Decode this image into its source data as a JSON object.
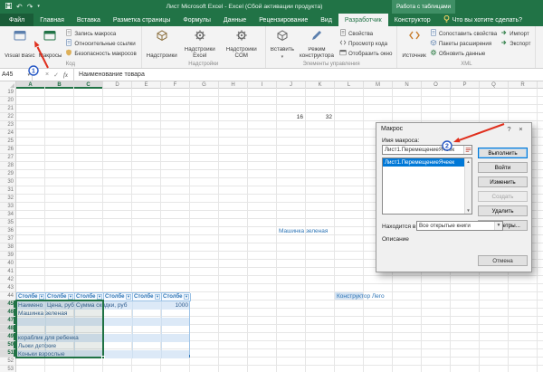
{
  "window": {
    "title": "Лист Microsoft Excel - Excel (Сбой активации продукта)",
    "context_group_label": "Работа с таблицами",
    "qat": [
      {
        "name": "save",
        "glyph": "save-icon"
      },
      {
        "name": "undo",
        "glyph": "↶"
      },
      {
        "name": "redo",
        "glyph": "↷"
      },
      {
        "name": "customize",
        "glyph": "▾"
      }
    ]
  },
  "tabs": [
    {
      "label": "Файл",
      "name": "file",
      "file": true
    },
    {
      "label": "Главная",
      "name": "home"
    },
    {
      "label": "Вставка",
      "name": "insert"
    },
    {
      "label": "Разметка страницы",
      "name": "page-layout"
    },
    {
      "label": "Формулы",
      "name": "formulas"
    },
    {
      "label": "Данные",
      "name": "data"
    },
    {
      "label": "Рецензирование",
      "name": "review"
    },
    {
      "label": "Вид",
      "name": "view"
    },
    {
      "label": "Разработчик",
      "name": "developer",
      "active": true
    },
    {
      "label": "Конструктор",
      "name": "design",
      "contextual": true
    }
  ],
  "tell_me": "Что вы хотите сделать?",
  "ribbon": {
    "groups": [
      {
        "label": "Код",
        "big": [
          {
            "label": "Visual Basic",
            "name": "visual-basic",
            "icon": "vb"
          },
          {
            "label": "Макросы",
            "name": "macros",
            "icon": "macros"
          }
        ],
        "small_cols": [
          [
            {
              "label": "Запись макроса",
              "name": "record-macro",
              "icon": "record"
            },
            {
              "label": "Относительные ссылки",
              "name": "relative-references",
              "icon": "relref"
            },
            {
              "label": "Безопасность макросов",
              "name": "macro-security",
              "icon": "security"
            }
          ]
        ]
      },
      {
        "label": "Надстройки",
        "big": [
          {
            "label": "Надстройки",
            "name": "add-ins",
            "icon": "addins"
          },
          {
            "label": "Надстройки Excel",
            "name": "excel-add-ins",
            "icon": "addins-excel"
          },
          {
            "label": "Надстройки COM",
            "name": "com-add-ins",
            "icon": "addins-com"
          }
        ],
        "small_cols": []
      },
      {
        "label": "Элементы управления",
        "big": [
          {
            "label": "Вставить",
            "name": "insert-controls",
            "icon": "insert",
            "menu": true
          },
          {
            "label": "Режим конструктора",
            "name": "design-mode",
            "icon": "design"
          }
        ],
        "small_cols": [
          [
            {
              "label": "Свойства",
              "name": "properties",
              "icon": "props"
            },
            {
              "label": "Просмотр кода",
              "name": "view-code",
              "icon": "code"
            },
            {
              "label": "Отобразить окно",
              "name": "show-window",
              "icon": "window"
            }
          ]
        ]
      },
      {
        "label": "XML",
        "big": [
          {
            "label": "Источник",
            "name": "source",
            "icon": "source"
          }
        ],
        "small_cols": [
          [
            {
              "label": "Сопоставить свойства",
              "name": "map-properties",
              "icon": "map"
            },
            {
              "label": "Пакеты расширения",
              "name": "expansion-packs",
              "icon": "expand"
            },
            {
              "label": "Обновить данные",
              "name": "refresh-data",
              "icon": "refresh"
            }
          ],
          [
            {
              "label": "Импорт",
              "name": "import",
              "icon": "import"
            },
            {
              "label": "Экспорт",
              "name": "export",
              "icon": "export"
            }
          ]
        ]
      }
    ]
  },
  "formula_bar": {
    "name_box": "A45",
    "formula": "Наименование товара"
  },
  "sheet": {
    "columns": [
      "A",
      "B",
      "C",
      "D",
      "E",
      "F",
      "G",
      "H",
      "I",
      "J",
      "K",
      "L",
      "M",
      "N",
      "O",
      "P",
      "Q",
      "R"
    ],
    "first_row": 19,
    "last_row": 53,
    "selected_columns": [
      "A",
      "B",
      "C"
    ],
    "selected_row_from": 45,
    "selected_row_to": 51,
    "selection_ref": "A45:C51",
    "cells": [
      {
        "ref": "J22",
        "col": "J",
        "row": 22,
        "value": "16",
        "style": "number"
      },
      {
        "ref": "K22",
        "col": "K",
        "row": 22,
        "value": "32",
        "style": "number"
      },
      {
        "ref": "J36",
        "col": "J",
        "row": 36,
        "value": "Машинка зеленая",
        "style": "blue"
      },
      {
        "ref": "L44",
        "col": "L",
        "row": 44,
        "value": "Конструктор Лего",
        "style": "blue-filled"
      }
    ],
    "table": {
      "first_row": 44,
      "header_cells": [
        "Столбе",
        "Столбе",
        "Столбе",
        "Столбе",
        "Столбе",
        "Столбе"
      ],
      "rows": [
        {
          "row": 45,
          "cells": [
            {
              "col": "A",
              "value": "Наимено",
              "clip": true
            },
            {
              "col": "B",
              "value": "Цена, руб",
              "clip": true
            },
            {
              "col": "C",
              "value": "Сумма скидки, руб"
            },
            {
              "col": "F",
              "value": "1000",
              "num": true
            }
          ]
        },
        {
          "row": 46,
          "cells": [
            {
              "col": "A",
              "value": "Машинка зеленая"
            }
          ]
        },
        {
          "row": 47,
          "cells": []
        },
        {
          "row": 48,
          "cells": []
        },
        {
          "row": 49,
          "cells": [
            {
              "col": "A",
              "value": "кораблик для ребенка"
            }
          ]
        },
        {
          "row": 50,
          "cells": [
            {
              "col": "A",
              "value": "Лыжи детские"
            }
          ]
        },
        {
          "row": 51,
          "cells": [
            {
              "col": "A",
              "value": "Коньки взрослые"
            }
          ]
        }
      ]
    }
  },
  "dialog": {
    "title": "Макрос",
    "help_glyph": "?",
    "close_glyph": "×",
    "name_label": "Имя макроса:",
    "name_value": "Лист1.ПеремещениеЯчеек",
    "list_items": [
      "Лист1.ПеремещениеЯчеек"
    ],
    "selected_item": "Лист1.ПеремещениеЯчеек",
    "buttons": [
      {
        "label": "Выполнить",
        "name": "run",
        "default": true
      },
      {
        "label": "Войти",
        "name": "step-into"
      },
      {
        "label": "Изменить",
        "name": "edit"
      },
      {
        "label": "Создать",
        "name": "create",
        "disabled": true
      },
      {
        "label": "Удалить",
        "name": "delete"
      },
      {
        "label": "Параметры...",
        "name": "options"
      }
    ],
    "location_label": "Находится в:",
    "location_value": "Все открытые книги",
    "description_label": "Описание",
    "cancel_label": "Отмена"
  },
  "annotations": {
    "step1": "1",
    "step2": "2"
  },
  "colors": {
    "excel_green": "#217346",
    "context_tab_green": "#3f8f65",
    "ribbon_bg": "#f3f3f3",
    "selection_blue": "#0078d7",
    "table_accent": "#2e75b6",
    "banded_row_blue": "#dce9f7",
    "annotation_red": "#e0301e",
    "annotation_circle_blue": "#2456c4"
  }
}
